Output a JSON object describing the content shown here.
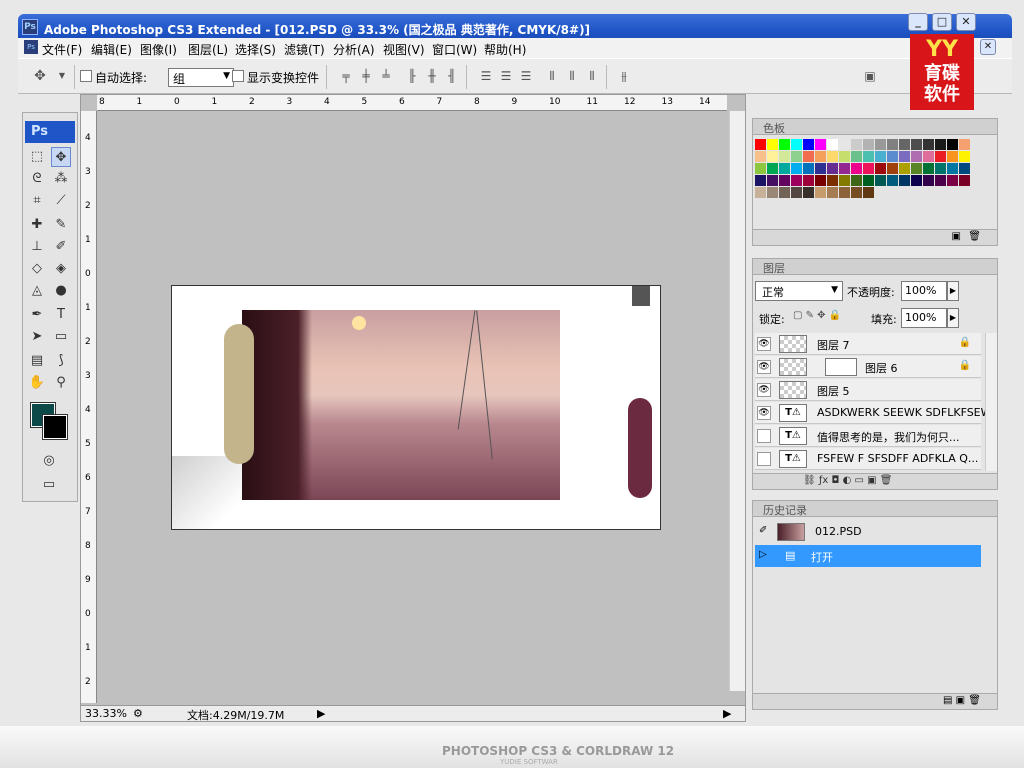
{
  "window": {
    "title": "Adobe Photoshop CS3 Extended - [012.PSD @ 33.3% (国之极品 典范著作, CMYK/8#)]",
    "app_icon": "Ps"
  },
  "menu": {
    "items": [
      "文件(F)",
      "编辑(E)",
      "图像(I)",
      "图层(L)",
      "选择(S)",
      "滤镜(T)",
      "分析(A)",
      "视图(V)",
      "窗口(W)",
      "帮助(H)"
    ]
  },
  "options": {
    "auto_select_label": "自动选择:",
    "auto_select_value": "组",
    "show_transform_label": "显示变换控件"
  },
  "logo": {
    "top": "YY",
    "line1": "育碟",
    "line2": "软件"
  },
  "toolbox": {
    "header": "Ps"
  },
  "rulers": {
    "h": [
      "8",
      "1",
      "0",
      "1",
      "2",
      "3",
      "4",
      "5",
      "6",
      "7",
      "8",
      "9",
      "10",
      "11",
      "12",
      "13",
      "14"
    ],
    "v": [
      "4",
      "3",
      "2",
      "1",
      "0",
      "1",
      "2",
      "3",
      "4",
      "5",
      "6",
      "7",
      "8",
      "9",
      "0",
      "1",
      "2"
    ]
  },
  "status": {
    "zoom": "33.33%",
    "doc": "文档:4.29M/19.7M"
  },
  "swatches_panel": {
    "title": "色板",
    "colors": [
      "#ff0000",
      "#ffff00",
      "#00ff00",
      "#00ffff",
      "#0000ff",
      "#ff00ff",
      "#ffffff",
      "#e6e6e6",
      "#cccccc",
      "#b3b3b3",
      "#999999",
      "#808080",
      "#666666",
      "#4d4d4d",
      "#333333",
      "#1a1a1a",
      "#000000",
      "#f4a070",
      "#f7c08a",
      "#fff09a",
      "#d4e89a",
      "#8ed18e",
      "#f26c4f",
      "#f5a05a",
      "#fdd86b",
      "#c6df6c",
      "#6cc08c",
      "#4cc0b0",
      "#4ab0d0",
      "#5c8cd0",
      "#7c6cc0",
      "#b06cb0",
      "#e06c9c",
      "#ec1c24",
      "#f7941d",
      "#fff200",
      "#8dc63f",
      "#00a651",
      "#00a99d",
      "#00aeef",
      "#0072bc",
      "#2e3192",
      "#662d91",
      "#92278f",
      "#ec008c",
      "#ed145b",
      "#9e0b0f",
      "#a0410d",
      "#aba000",
      "#598527",
      "#007236",
      "#00746b",
      "#0076a3",
      "#004a80",
      "#1b1464",
      "#440e62",
      "#630460",
      "#9e005d",
      "#9e0039",
      "#790000",
      "#7b2e00",
      "#827b00",
      "#406618",
      "#005e20",
      "#005952",
      "#005b7f",
      "#003663",
      "#0d004c",
      "#32004b",
      "#4b0049",
      "#7b0046",
      "#7a0026",
      "#c7b299",
      "#998675",
      "#736357",
      "#534741",
      "#37302a",
      "#c69c6d",
      "#a67c52",
      "#8c6239",
      "#754c24",
      "#603913"
    ]
  },
  "layers_panel": {
    "title": "图层",
    "blend_mode": "正常",
    "opacity_label": "不透明度:",
    "opacity_value": "100%",
    "lock_label": "锁定:",
    "fill_label": "填充:",
    "fill_value": "100%",
    "layers": [
      {
        "name": "图层 7",
        "type": "pixel",
        "visible": true,
        "locked": true
      },
      {
        "name": "图层 6",
        "type": "masked",
        "visible": true,
        "locked": true
      },
      {
        "name": "图层 5",
        "type": "pixel",
        "visible": true,
        "locked": false
      },
      {
        "name": "ASDKWERK SEEWK  SDFLKFSEW",
        "type": "text",
        "visible": true,
        "locked": false
      },
      {
        "name": "值得思考的是，我们为何只...",
        "type": "text",
        "visible": false,
        "locked": false
      },
      {
        "name": "FSFEW F SFSDFF  ADFKLA Q...",
        "type": "text",
        "visible": false,
        "locked": false
      }
    ]
  },
  "history_panel": {
    "title": "历史记录",
    "snapshot": "012.PSD",
    "steps": [
      "打开"
    ]
  },
  "watermark": {
    "text": "PHOTOSHOP CS3 & CORLDRAW 12",
    "sub": "YUDIE SOFTWAR"
  }
}
